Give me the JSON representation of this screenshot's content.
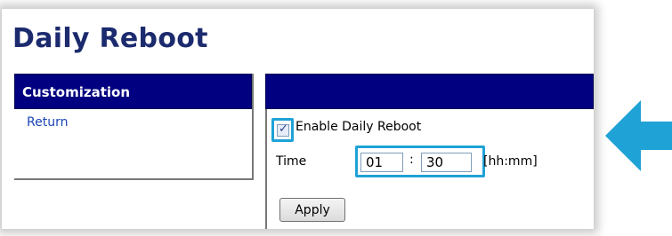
{
  "page": {
    "title": "Daily Reboot"
  },
  "sidebar": {
    "header": "Customization",
    "items": [
      {
        "label": "Return"
      }
    ]
  },
  "form": {
    "enable_label": "Enable Daily Reboot",
    "enable_checked": true,
    "time_label": "Time",
    "hours": "01",
    "separator": ":",
    "minutes": "30",
    "format_hint": "[hh:mm]",
    "apply_label": "Apply"
  },
  "colors": {
    "header_bg": "#000080",
    "title": "#1c2a6e",
    "highlight": "#1fa2d6",
    "link": "#1a45b5"
  },
  "icons": {
    "pointer": "arrow-left-icon",
    "checkbox_tick": "check-icon"
  }
}
